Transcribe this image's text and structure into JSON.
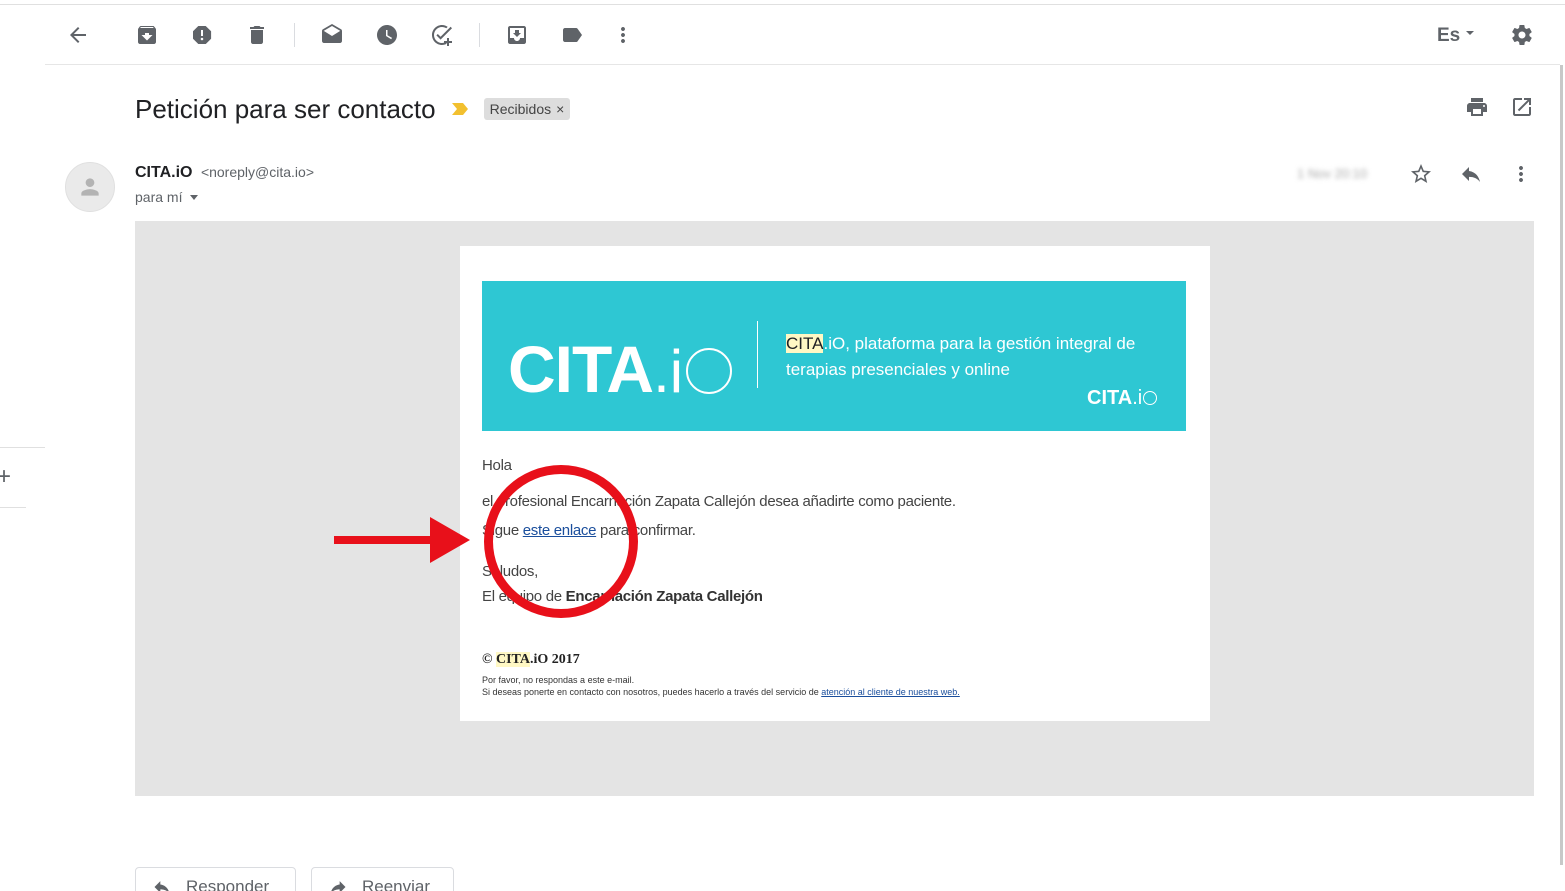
{
  "toolbar": {
    "language": "Es"
  },
  "subject": {
    "title": "Petición para ser contacto",
    "label": "Recibidos",
    "label_remove": "×"
  },
  "message": {
    "sender_name": "CITA.iO",
    "sender_email": "<noreply@cita.io>",
    "to": "para mí",
    "date": "1 Nov 20:10"
  },
  "email": {
    "banner": {
      "logo_main": "CITA",
      "logo_suffix": ".i",
      "highlight": "CITA",
      "tagline_rest": ".iO, plataforma para la gestión integral de terapias presenciales y online",
      "small_logo_main": "CITA",
      "small_logo_suffix": ".i"
    },
    "greeting": "Hola",
    "line1": "el profesional Encarnación Zapata Callejón desea añadirte como paciente.",
    "line2_before": "Sigue ",
    "line2_link": "este enlace",
    "line2_after": " para confirmar.",
    "closing": "Saludos,",
    "team_prefix": "El equipo de ",
    "team_name": "Encarnación Zapata Callejón",
    "footer": {
      "copyright_symbol": "© ",
      "brand_highlight": "CITA",
      "brand_rest": ".iO 2017",
      "note1": "Por favor, no respondas a este e-mail.",
      "note2_before": "Si deseas ponerte en contacto con nosotros, puedes hacerlo a través del servicio de ",
      "note2_link": "atención al cliente de nuestra web."
    }
  },
  "actions": {
    "reply": "Responder",
    "forward": "Reenviar"
  },
  "colors": {
    "banner": "#2ec7d3",
    "annotation": "#e8101a",
    "highlight": "#fff8c4",
    "link": "#1a4e9c"
  }
}
